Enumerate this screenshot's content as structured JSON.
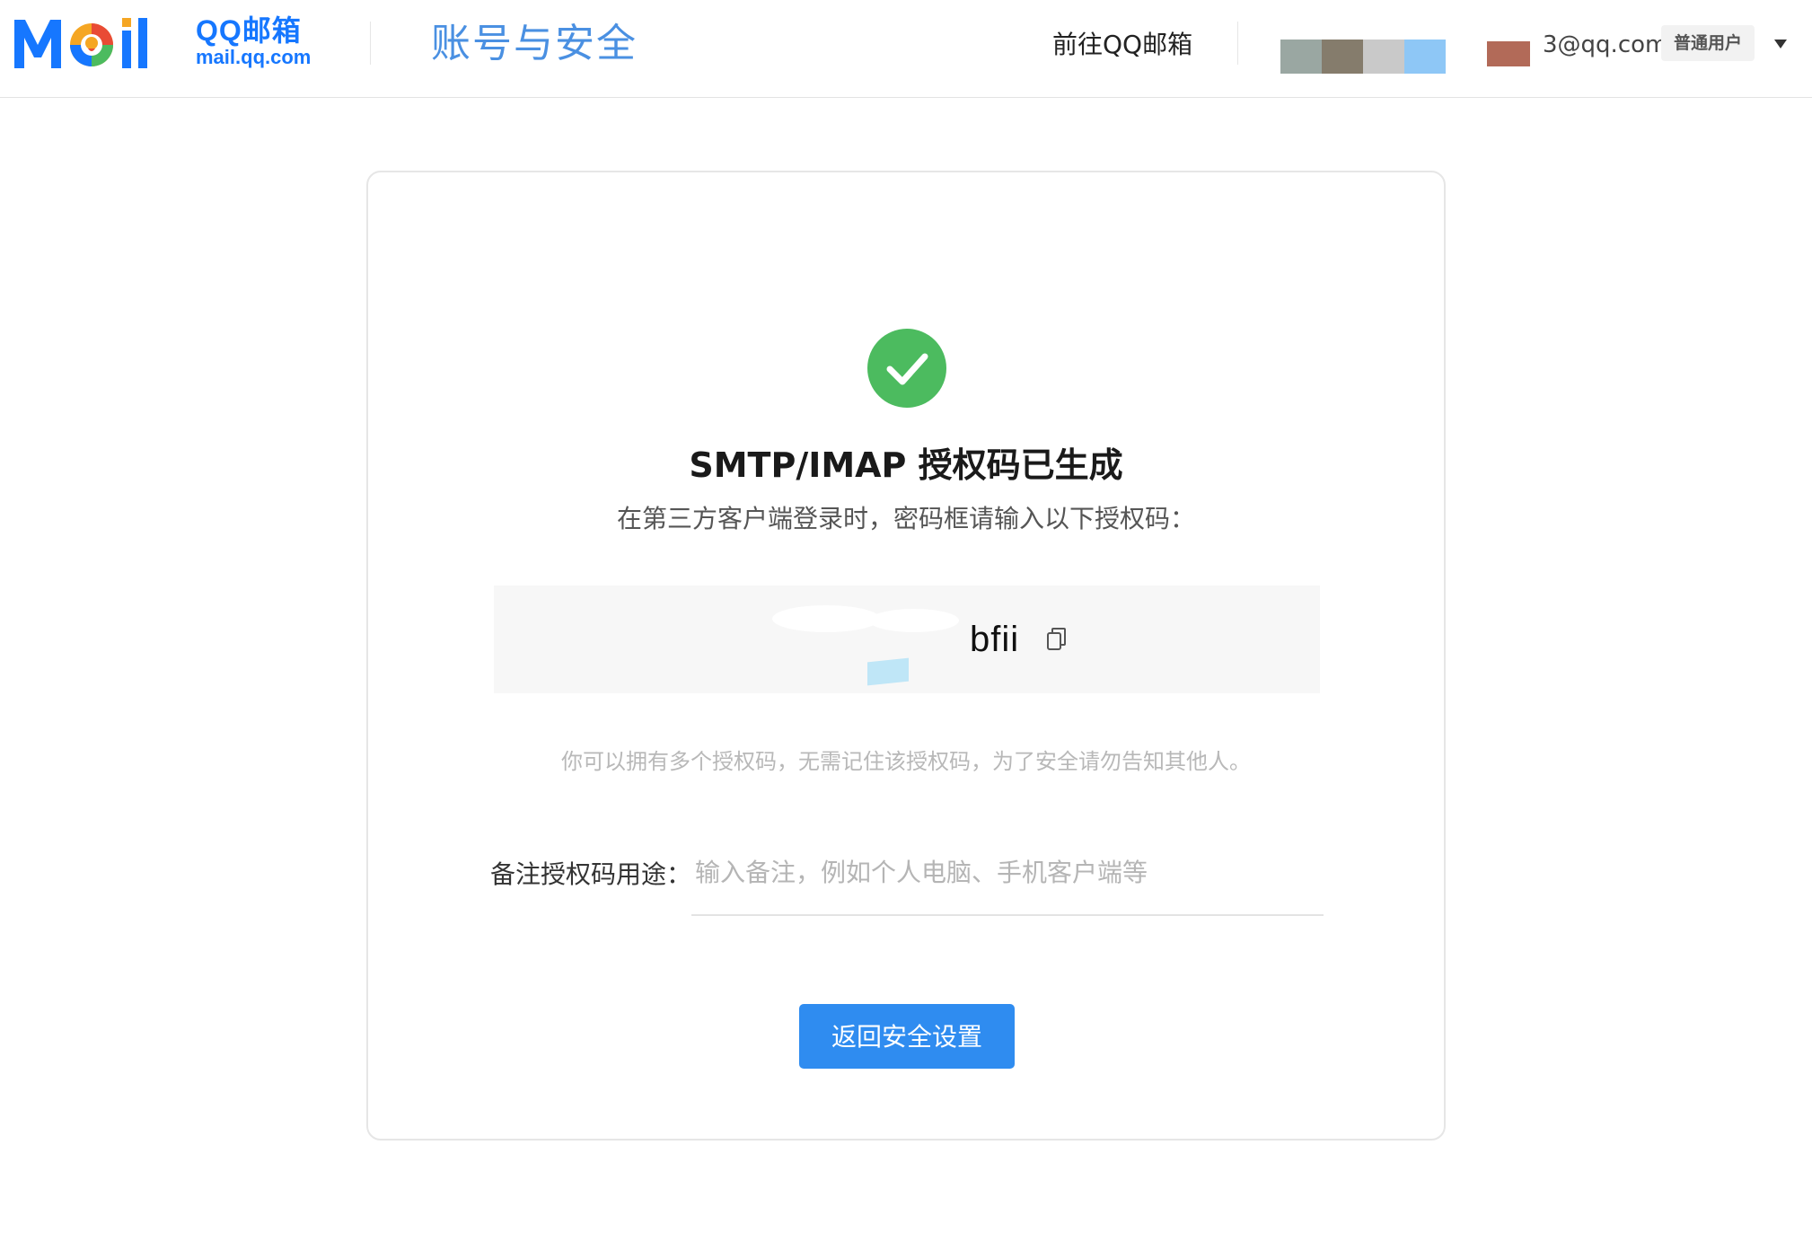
{
  "header": {
    "logo_wordmark": "Mail",
    "logo_name": "QQ邮箱",
    "logo_domain": "mail.qq.com",
    "page_name": "账号与安全",
    "goto_link": "前往QQ邮箱",
    "account_email": "3@qq.com",
    "user_badge": "普通用户",
    "menu_icon": "caret-down-icon"
  },
  "main": {
    "status_icon": "check-circle-icon",
    "title": "SMTP/IMAP 授权码已生成",
    "subtitle": "在第三方客户端登录时，密码框请输入以下授权码：",
    "auth_code_visible": "bfii",
    "copy_icon": "copy-icon",
    "hint": "你可以拥有多个授权码，无需记住该授权码，为了安全请勿告知其他人。",
    "note_label": "备注授权码用途：",
    "note_placeholder": "输入备注，例如个人电脑、手机客户端等",
    "note_value": "",
    "back_button": "返回安全设置"
  },
  "colors": {
    "accent": "#2f8cf0",
    "page_name": "#4a90e2",
    "success": "#4cbb5f",
    "logo_blue": "#1677ff"
  }
}
